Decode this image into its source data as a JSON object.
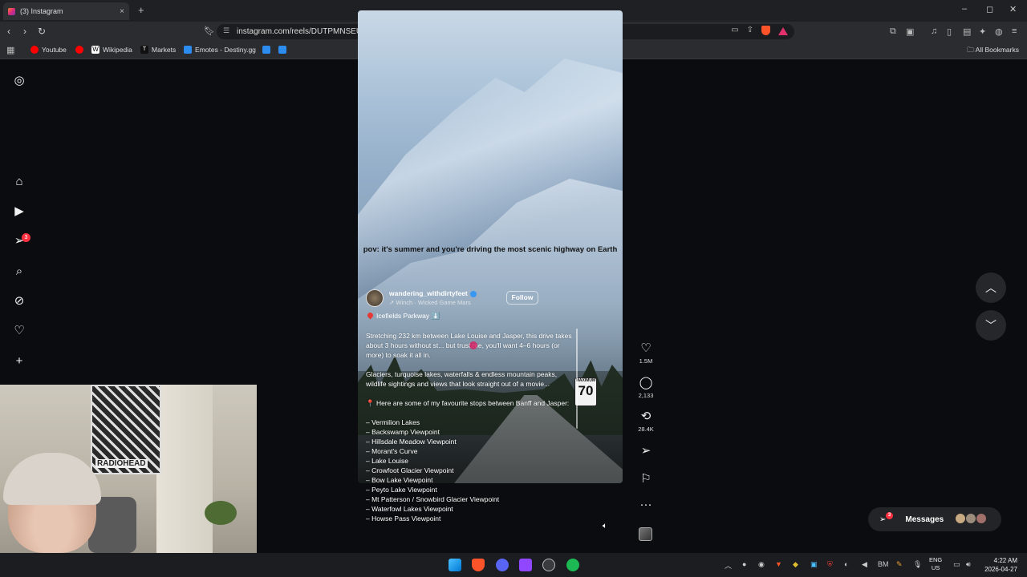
{
  "browser": {
    "tab_title": "(3) Instagram",
    "tab_close": "×",
    "new_tab": "+",
    "url": "instagram.com/reels/DUTPMNSEUHp/",
    "window_controls": [
      "–",
      "◻",
      "✕"
    ],
    "bookmarks": [
      {
        "label": "Youtube",
        "color": "#ff0000"
      },
      {
        "label": "",
        "color": "#ff0000"
      },
      {
        "label": "Wikipedia",
        "color": "#ffffff"
      },
      {
        "label": "Markets",
        "color": "#111111"
      },
      {
        "label": "Emotes - Destiny.gg",
        "color": "#2d8cf0"
      },
      {
        "label": "",
        "color": "#2d8cf0"
      },
      {
        "label": "",
        "color": "#2d8cf0"
      }
    ],
    "all_bookmarks": "All Bookmarks"
  },
  "reel": {
    "overlay_text": "pov: it's summer and you're driving the most scenic highway on Earth",
    "username": "wandering_withdirtyfeet",
    "audio": "↗  Winch · Wicked Game          Mars",
    "follow_label": "Follow",
    "location": "Icefields Parkway ⬇️",
    "caption_p1": "Stretching 232 km between Lake Louise and Jasper, this drive takes about 3 hours without st... but trust me, you'll want 4–6 hours (or more) to soak it all in.",
    "caption_p2": "Glaciers, turquoise lakes, waterfalls & endless mountain peaks, wildlife sightings and views that look straight out of a movie...",
    "caption_p3": "📍 Here are some of my favourite stops between Banff and Jasper:",
    "stops": [
      "– Vermilion Lakes",
      "– Backswamp Viewpoint",
      "– Hillsdale Meadow Viewpoint",
      "– Morant's Curve",
      "– Lake Louise",
      "– Crowfoot Glacier Viewpoint",
      "– Bow Lake Viewpoint",
      "– Peyto Lake Viewpoint",
      "– Mt Patterson / Snowbird Glacier Viewpoint",
      "– Waterfowl Lakes Viewpoint",
      "– Howse Pass Viewpoint"
    ],
    "sign_top": "MAXIMUM",
    "sign_value": "70"
  },
  "actions": {
    "likes": "1.5M",
    "comments": "2,133",
    "reposts": "28.4K"
  },
  "sidebar": {
    "notification_count": "3"
  },
  "messages": {
    "label": "Messages",
    "count": "3"
  },
  "webcam": {
    "poster_text": "RADIOHEAD"
  },
  "taskbar": {
    "lang_1": "ENG",
    "lang_2": "US",
    "time": "4:22 AM",
    "date": "2026-04-27"
  }
}
